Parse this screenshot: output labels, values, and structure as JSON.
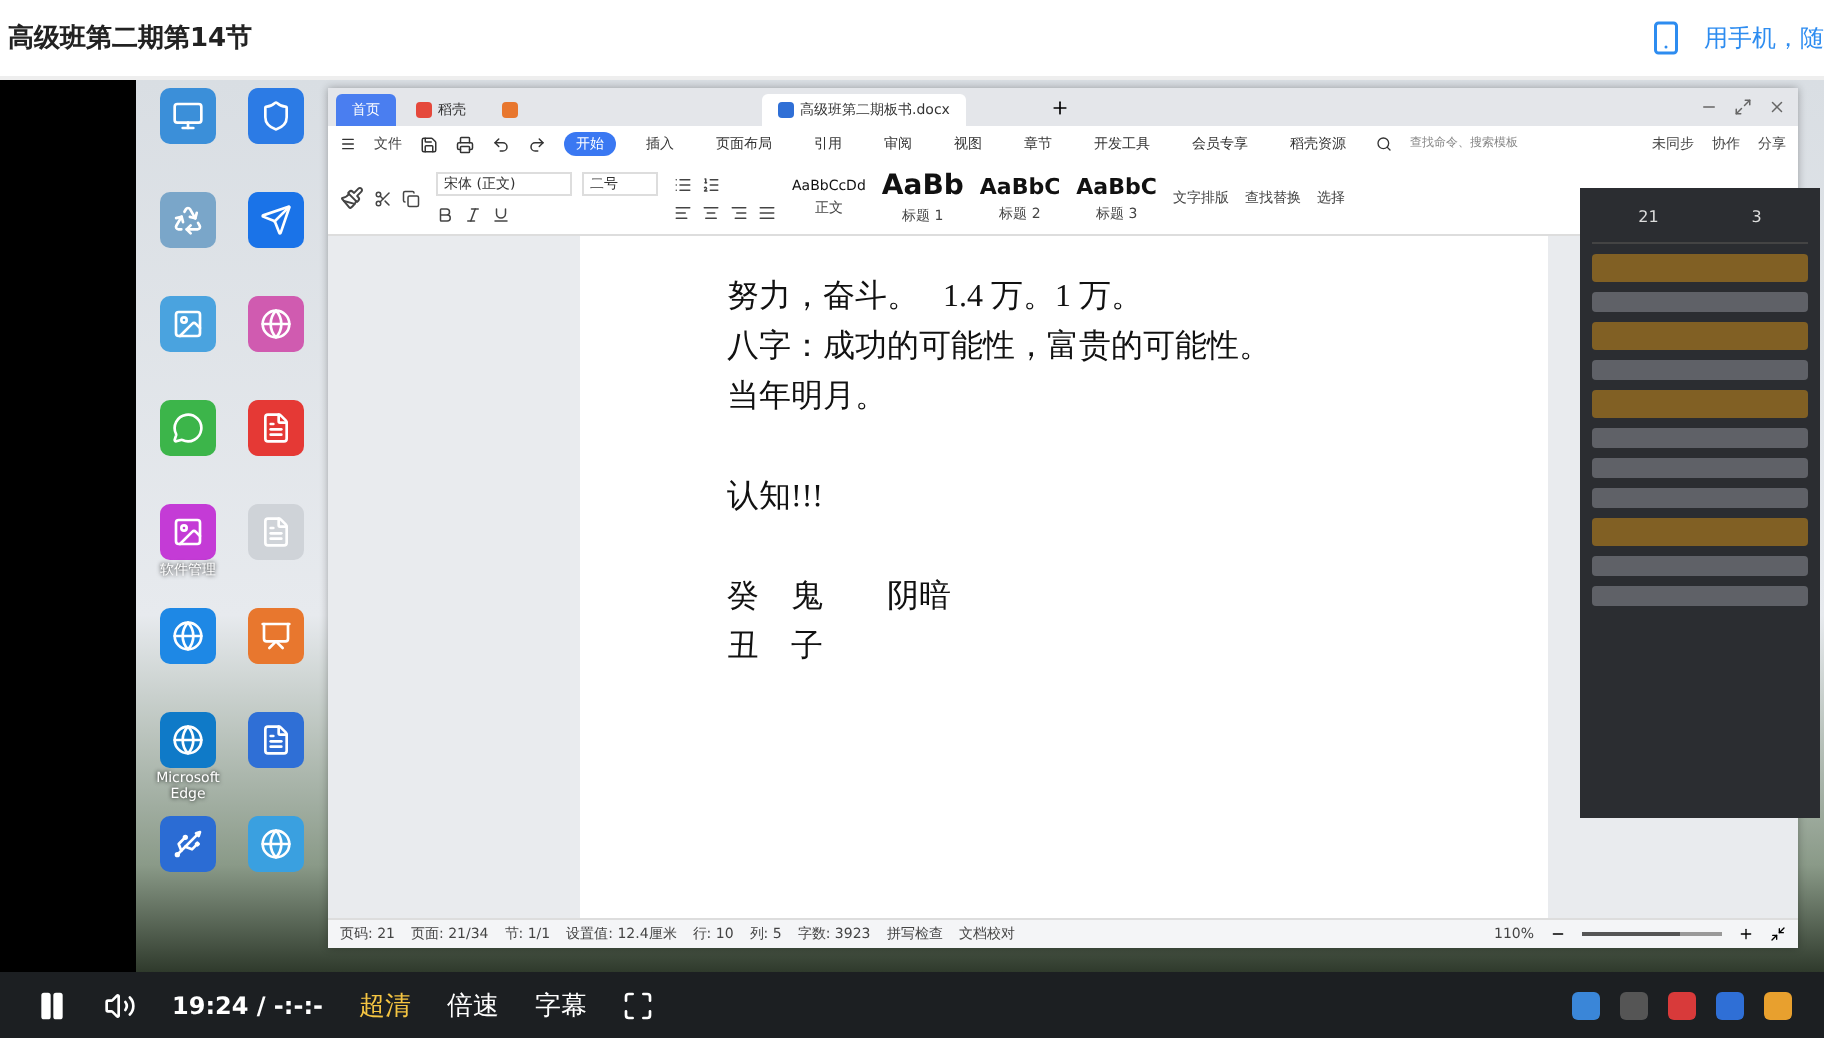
{
  "header": {
    "title": "高级班第二期第14节",
    "mobile_link": "用手机，随"
  },
  "desktop": {
    "icons": [
      {
        "kind": "monitor"
      },
      {
        "kind": "shield"
      },
      {
        "kind": "recycle"
      },
      {
        "kind": "arrow"
      },
      {
        "kind": "photo"
      },
      {
        "kind": "palette"
      },
      {
        "kind": "chat"
      },
      {
        "kind": "wps"
      },
      {
        "kind": "app",
        "label": "软件管理"
      },
      {
        "kind": "doc"
      },
      {
        "kind": "ie"
      },
      {
        "kind": "ppt"
      },
      {
        "kind": "edge",
        "label": "Microsoft Edge"
      },
      {
        "kind": "word"
      },
      {
        "kind": "usb"
      },
      {
        "kind": "globe"
      }
    ]
  },
  "wps": {
    "tabs": [
      {
        "label": "首页",
        "kind": "home",
        "selected": false
      },
      {
        "label": "稻壳",
        "kind": "docer",
        "selected": false
      },
      {
        "kind": "pptx",
        "selected": false
      },
      {
        "label": "高级班第二期板书.docx",
        "kind": "docx",
        "selected": true
      }
    ],
    "menu_file": "文件",
    "ribbon_tabs": [
      {
        "label": "开始",
        "selected": true
      },
      {
        "label": "插入",
        "selected": false
      },
      {
        "label": "页面布局",
        "selected": false
      },
      {
        "label": "引用",
        "selected": false
      },
      {
        "label": "审阅",
        "selected": false
      },
      {
        "label": "视图",
        "selected": false
      },
      {
        "label": "章节",
        "selected": false
      },
      {
        "label": "开发工具",
        "selected": false
      },
      {
        "label": "会员专享",
        "selected": false
      },
      {
        "label": "稻壳资源",
        "selected": false
      }
    ],
    "command_search": {
      "placeholder": "查找命令、搜索模板"
    },
    "right_actions": [
      "未同步",
      "协作",
      "分享"
    ],
    "font_name": "宋体 (正文)",
    "font_size": "二号",
    "styles": [
      {
        "preview": "AaBbCcDd",
        "label": "正文"
      },
      {
        "preview": "AaBb",
        "label": "标题 1"
      },
      {
        "preview": "AaBbC",
        "label": "标题 2"
      },
      {
        "preview": "AaBbC",
        "label": "标题 3"
      }
    ],
    "style_tools": [
      "文字排版",
      "查找替换",
      "选择"
    ],
    "document_blocks": [
      [
        "努力，奋斗。   1.4 万。1 万。",
        "八字：成功的可能性，富贵的可能性。",
        "当年明月。"
      ],
      [
        "认知!!!"
      ],
      [
        "癸　鬼　　阴暗",
        "丑　子"
      ]
    ],
    "status_items": [
      "页码: 21",
      "页面: 21/34",
      "节: 1/1",
      "设置值: 12.4厘米",
      "行: 10",
      "列: 5",
      "字数: 3923",
      "拼写检查",
      "文档校对"
    ],
    "zoom": {
      "reading": "110%",
      "level": 0.7
    }
  },
  "chat": {
    "stats": [
      "21",
      "3"
    ],
    "messages": [
      {
        "kind": "notice"
      },
      {
        "kind": "chat"
      },
      {
        "kind": "notice"
      },
      {
        "kind": "chat"
      },
      {
        "kind": "notice"
      },
      {
        "kind": "chat"
      },
      {
        "kind": "chat"
      },
      {
        "kind": "chat"
      },
      {
        "kind": "notice"
      },
      {
        "kind": "chat"
      },
      {
        "kind": "chat"
      }
    ]
  },
  "player": {
    "playing": true,
    "time": "19:24 / -:-:-",
    "quality": "超清",
    "speed": "倍速",
    "subtitles": "字幕"
  }
}
